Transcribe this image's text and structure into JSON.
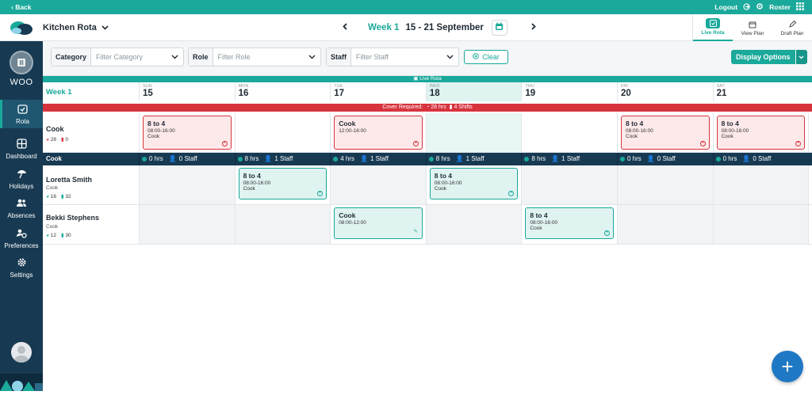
{
  "topbar": {
    "back": "‹ Back",
    "logout": "Logout",
    "roster": "Roster"
  },
  "header": {
    "app_title": "Kitchen Rota",
    "week_label": "Week 1",
    "date_range": "15 - 21 September"
  },
  "views": [
    {
      "label": "Live Rota",
      "icon": "live-rota-icon"
    },
    {
      "label": "View Plan",
      "icon": "view-plan-icon"
    },
    {
      "label": "Draft Plan",
      "icon": "draft-plan-icon"
    }
  ],
  "sidebar": {
    "org": "WOO",
    "items": [
      {
        "label": "Rota",
        "icon": "rota-icon",
        "active": true
      },
      {
        "label": "Dashboard",
        "icon": "dashboard-icon"
      },
      {
        "label": "Holidays",
        "icon": "holidays-icon"
      },
      {
        "label": "Absences",
        "icon": "absences-icon"
      },
      {
        "label": "Preferences",
        "icon": "preferences-icon"
      },
      {
        "label": "Settings",
        "icon": "settings-icon"
      }
    ]
  },
  "filters": {
    "category": {
      "label": "Category",
      "placeholder": "Filter Category"
    },
    "role": {
      "label": "Role",
      "placeholder": "Filter Role"
    },
    "staff": {
      "label": "Staff",
      "placeholder": "Filter Staff"
    },
    "clear": "Clear",
    "display_options": "Display Options"
  },
  "grid": {
    "live_label": "Live Rota",
    "week_label": "Week 1",
    "days": [
      {
        "name": "SUN",
        "num": "15"
      },
      {
        "name": "MON",
        "num": "16"
      },
      {
        "name": "TUE",
        "num": "17"
      },
      {
        "name": "WED",
        "num": "18"
      },
      {
        "name": "THU",
        "num": "19"
      },
      {
        "name": "FRI",
        "num": "20"
      },
      {
        "name": "SAT",
        "num": "21"
      }
    ],
    "cover": {
      "label": "Cover Required:",
      "hours": "28 hrs",
      "shifts": "4 Shifts"
    },
    "cover_row": {
      "name": "Cook",
      "stat_a": "28",
      "stat_b": "0"
    },
    "summary": {
      "label": "Cook",
      "cells": [
        {
          "hours": "0 hrs",
          "staff": "0 Staff"
        },
        {
          "hours": "8 hrs",
          "staff": "1 Staff"
        },
        {
          "hours": "4 hrs",
          "staff": "1 Staff"
        },
        {
          "hours": "8 hrs",
          "staff": "1 Staff"
        },
        {
          "hours": "8 hrs",
          "staff": "1 Staff"
        },
        {
          "hours": "0 hrs",
          "staff": "0 Staff"
        },
        {
          "hours": "0 hrs",
          "staff": "0 Staff"
        }
      ]
    },
    "staff": [
      {
        "name": "Loretta Smith",
        "role": "Cook",
        "stat_a": "16",
        "stat_b": "32"
      },
      {
        "name": "Bekki Stephens",
        "role": "Cook",
        "stat_a": "12",
        "stat_b": "30"
      }
    ],
    "shifts": [
      {
        "row": "cover",
        "day": 0,
        "title": "8 to 4",
        "time": "08:00-16:00",
        "role": "Cook",
        "style": "red"
      },
      {
        "row": "cover",
        "day": 2,
        "title": "Cook",
        "time": "12:00-16:00",
        "role": "",
        "style": "red"
      },
      {
        "row": "cover",
        "day": 5,
        "title": "8 to 4",
        "time": "08:00-16:00",
        "role": "Cook",
        "style": "red"
      },
      {
        "row": "cover",
        "day": 6,
        "title": "8 to 4",
        "time": "08:00-16:00",
        "role": "Cook",
        "style": "red"
      },
      {
        "row": "staff0",
        "day": 1,
        "title": "8 to 4",
        "time": "08:00-16:00",
        "role": "Cook",
        "style": "teal"
      },
      {
        "row": "staff0",
        "day": 3,
        "title": "8 to 4",
        "time": "08:00-16:00",
        "role": "Cook",
        "style": "teal"
      },
      {
        "row": "staff1",
        "day": 2,
        "title": "Cook",
        "time": "08:00-12:00",
        "role": "",
        "style": "teal",
        "icon": "pencil-icon"
      },
      {
        "row": "staff1",
        "day": 4,
        "title": "8 to 4",
        "time": "08:00-16:00",
        "role": "Cook",
        "style": "teal"
      }
    ]
  },
  "colors": {
    "accent": "#1aa99a",
    "sidebar": "#173a52",
    "alert": "#d7333d",
    "fab": "#1f78c4"
  }
}
